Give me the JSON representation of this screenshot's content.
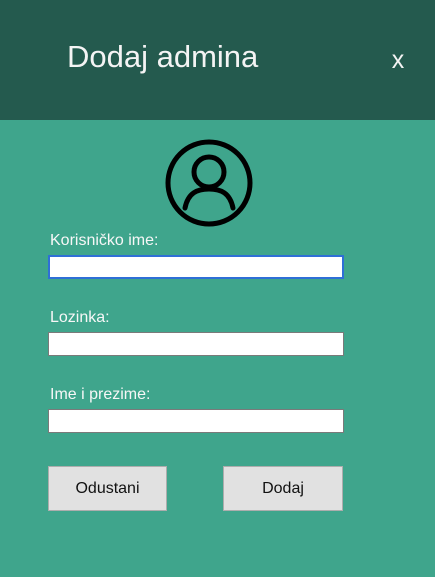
{
  "window": {
    "title": "Dodaj admina",
    "close_label": "x"
  },
  "avatar": {
    "icon": "user-circle-icon"
  },
  "form": {
    "username": {
      "label": "Korisničko ime:",
      "value": "",
      "focused": true
    },
    "password": {
      "label": "Lozinka:",
      "value": ""
    },
    "full_name": {
      "label": "Ime i prezime:",
      "value": ""
    }
  },
  "buttons": {
    "cancel_label": "Odustani",
    "add_label": "Dodaj"
  },
  "colors": {
    "header_bg": "#245a4e",
    "body_bg": "#3fa58c",
    "button_bg": "#e1e1e1",
    "focus_border": "#2f6fd6"
  }
}
